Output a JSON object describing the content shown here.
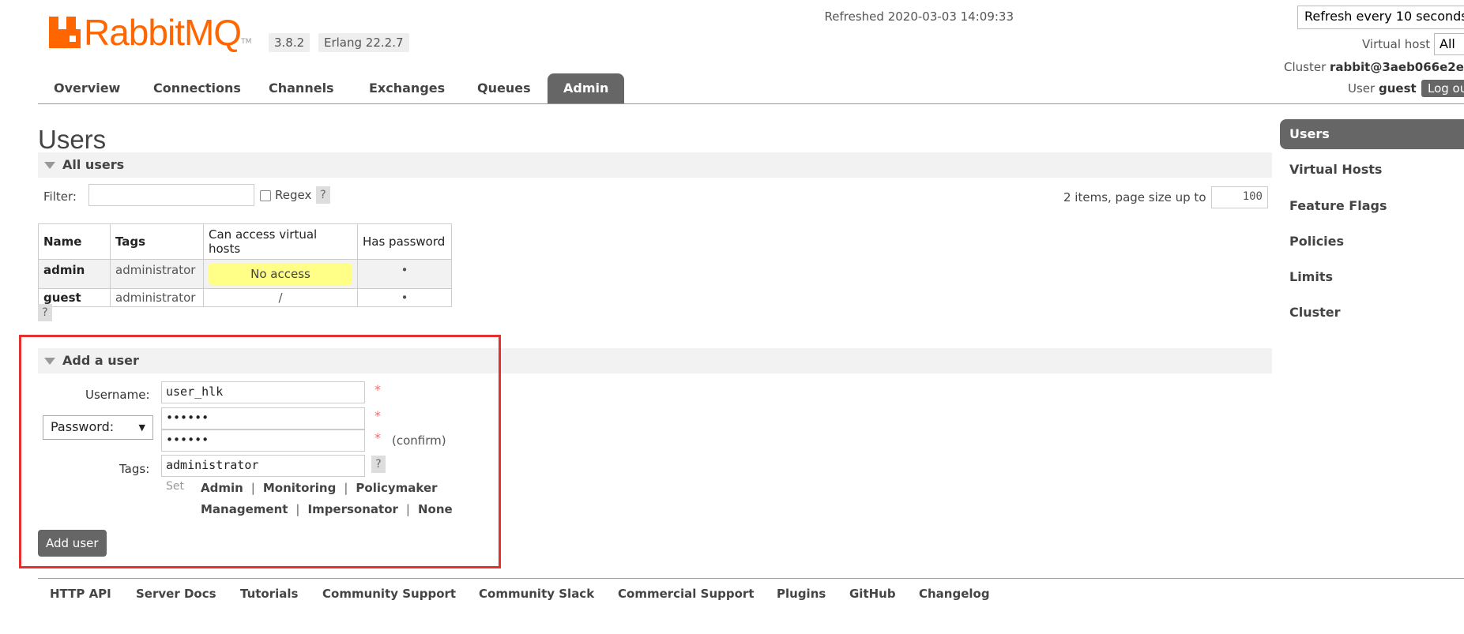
{
  "header": {
    "logo_text": "RabbitMQ",
    "logo_tm": "TM",
    "version": "3.8.2",
    "erlang": "Erlang 22.2.7",
    "refreshed_label": "Refreshed",
    "refreshed_time": "2020-03-03 14:09:33",
    "refresh_select": "Refresh every 10 seconds",
    "virtual_host_label": "Virtual host",
    "virtual_host_value": "All",
    "cluster_label": "Cluster",
    "cluster_value": "rabbit@3aeb066e2e",
    "user_label": "User",
    "user_value": "guest",
    "logout_label": "Log ou"
  },
  "tabs": [
    "Overview",
    "Connections",
    "Channels",
    "Exchanges",
    "Queues",
    "Admin"
  ],
  "active_tab": "Admin",
  "page_title": "Users",
  "all_users": {
    "title": "All users",
    "filter_label": "Filter:",
    "filter_value": "",
    "regex_label": "Regex",
    "help": "?",
    "items_text": "2 items, page size up to",
    "page_size": "100",
    "columns": [
      "Name",
      "Tags",
      "Can access virtual hosts",
      "Has password"
    ],
    "rows": [
      {
        "name": "admin",
        "tags": "administrator",
        "vhosts": "No access",
        "has_password": "•"
      },
      {
        "name": "guest",
        "tags": "administrator",
        "vhosts": "/",
        "has_password": "•"
      }
    ]
  },
  "add_user": {
    "title": "Add a user",
    "username_label": "Username:",
    "username_value": "user_hlk",
    "password_select": "Password:",
    "password_value": "••••••",
    "confirm_value": "••••••",
    "confirm_label": "(confirm)",
    "required_mark": "*",
    "tags_label": "Tags:",
    "tags_value": "administrator",
    "set_label": "Set",
    "tag_links_row1": [
      "Admin",
      "Monitoring",
      "Policymaker"
    ],
    "tag_links_row2": [
      "Management",
      "Impersonator",
      "None"
    ],
    "separator": "|",
    "submit_label": "Add user"
  },
  "sidebar": {
    "items": [
      "Users",
      "Virtual Hosts",
      "Feature Flags",
      "Policies",
      "Limits",
      "Cluster"
    ],
    "active": "Users"
  },
  "footer": {
    "links": [
      "HTTP API",
      "Server Docs",
      "Tutorials",
      "Community Support",
      "Community Slack",
      "Commercial Support",
      "Plugins",
      "GitHub",
      "Changelog"
    ]
  },
  "colors": {
    "brand": "#ff6600",
    "tab_active": "#666666",
    "highlight": "#e53030",
    "no_access_bg": "#ffff88"
  }
}
